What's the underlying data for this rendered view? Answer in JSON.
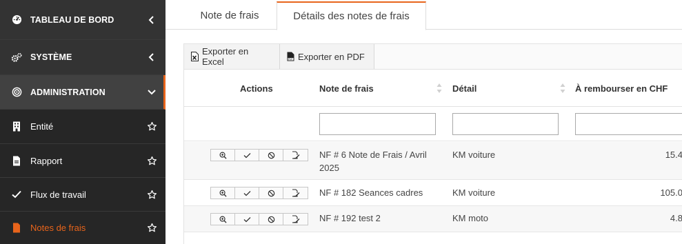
{
  "sidebar": {
    "items": [
      {
        "label": "TABLEAU DE BORD",
        "icon": "dashboard-icon",
        "chevron": "chevron-left-icon"
      },
      {
        "label": "SYSTÈME",
        "icon": "cogs-icon",
        "chevron": "chevron-left-icon"
      },
      {
        "label": "ADMINISTRATION",
        "icon": "target-icon",
        "chevron": "chevron-down-icon"
      },
      {
        "label": "Entité",
        "icon": "building-icon",
        "favorite": "star-icon"
      },
      {
        "label": "Rapport",
        "icon": "file-icon",
        "favorite": "star-icon"
      },
      {
        "label": "Flux de travail",
        "icon": "check-icon",
        "favorite": "star-icon"
      },
      {
        "label": "Notes de frais",
        "icon": "file-icon",
        "favorite": "star-icon"
      }
    ],
    "accent_color": "#e8641b"
  },
  "tabs": [
    {
      "label": "Note de frais"
    },
    {
      "label": "Détails des notes de frais"
    }
  ],
  "toolbar": {
    "excel_label": "Exporter en Excel",
    "pdf_label": "Exporter en PDF"
  },
  "table": {
    "columns": [
      "Actions",
      "Note de frais",
      "Détail",
      "À rembourser en CHF"
    ],
    "rows": [
      {
        "note": "NF # 6 Note de Frais / Avril 2025",
        "detail": "KM voiture",
        "amount": "15.4"
      },
      {
        "note": "NF # 182 Seances cadres",
        "detail": "KM voiture",
        "amount": "105.0"
      },
      {
        "note": "NF # 192 test 2",
        "detail": "KM moto",
        "amount": "4.8"
      }
    ],
    "action_icons": [
      "zoom-in-icon",
      "check-icon",
      "ban-icon",
      "edit-doc-icon"
    ]
  }
}
